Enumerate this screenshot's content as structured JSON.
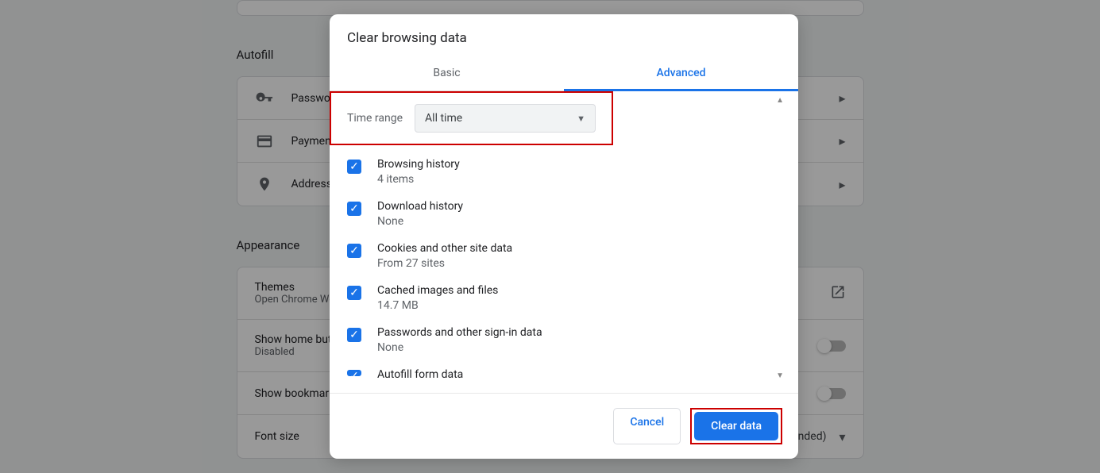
{
  "background": {
    "autofill_section": "Autofill",
    "autofill_items": [
      {
        "label": "Passwords"
      },
      {
        "label": "Payment methods"
      },
      {
        "label": "Addresses and more"
      }
    ],
    "appearance_section": "Appearance",
    "themes_title": "Themes",
    "themes_sub": "Open Chrome Web Store",
    "show_home_title": "Show home button",
    "show_home_sub": "Disabled",
    "show_bookmarks_title": "Show bookmarks bar",
    "font_size_title": "Font size",
    "font_size_value": "Medium (Recommended)"
  },
  "dialog": {
    "title": "Clear browsing data",
    "tabs": {
      "basic": "Basic",
      "advanced": "Advanced"
    },
    "time_range_label": "Time range",
    "time_range_value": "All time",
    "items": [
      {
        "title": "Browsing history",
        "sub": "4 items"
      },
      {
        "title": "Download history",
        "sub": "None"
      },
      {
        "title": "Cookies and other site data",
        "sub": "From 27 sites"
      },
      {
        "title": "Cached images and files",
        "sub": "14.7 MB"
      },
      {
        "title": "Passwords and other sign-in data",
        "sub": "None"
      },
      {
        "title": "Autofill form data",
        "sub": ""
      }
    ],
    "cancel": "Cancel",
    "clear": "Clear data"
  }
}
